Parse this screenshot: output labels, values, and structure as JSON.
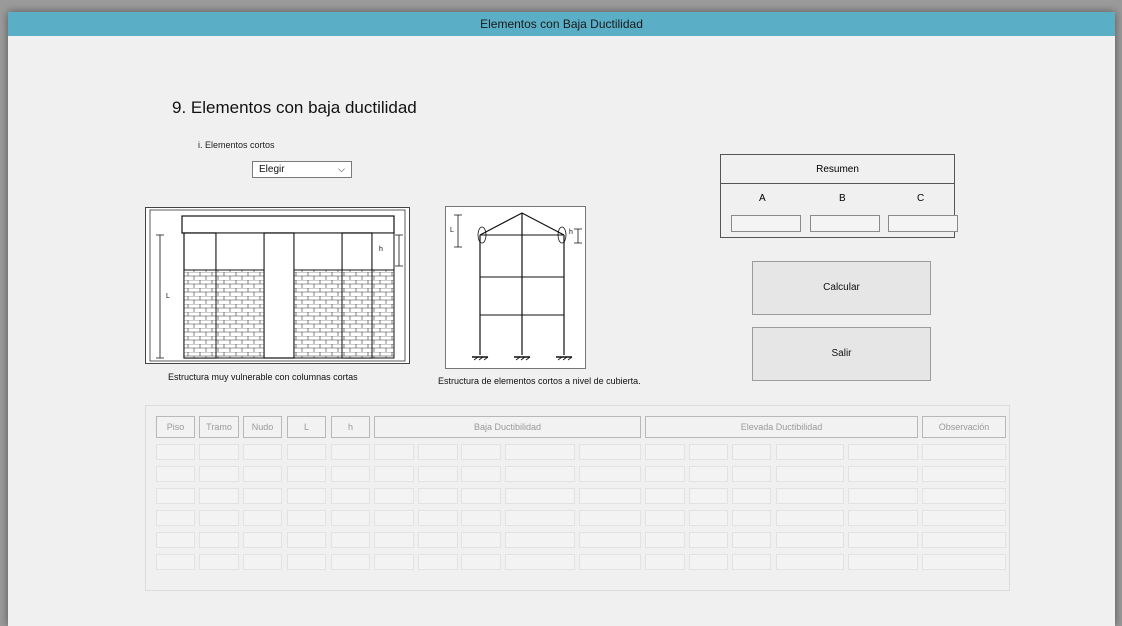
{
  "window": {
    "title": "Elementos con Baja Ductilidad"
  },
  "heading": "9. Elementos con baja ductilidad",
  "section": {
    "label": "i. Elementos cortos"
  },
  "select": {
    "value": "Elegir"
  },
  "figures": {
    "fig1": {
      "caption": "Estructura muy vulnerable con columnas  cortas",
      "label_L": "L",
      "label_h": "h"
    },
    "fig2": {
      "caption": "Estructura de elementos cortos a nivel de cubierta.",
      "label_L": "L",
      "label_h": "h"
    }
  },
  "resumen": {
    "title": "Resumen",
    "columns": [
      "A",
      "B",
      "C"
    ]
  },
  "buttons": {
    "calcular": "Calcular",
    "salir": "Salir"
  },
  "table": {
    "headers": [
      "Piso",
      "Tramo",
      "Nudo",
      "L",
      "h",
      "Baja Ductibilidad",
      "Elevada Ductibilidad",
      "Observación"
    ],
    "row_count": 6
  }
}
